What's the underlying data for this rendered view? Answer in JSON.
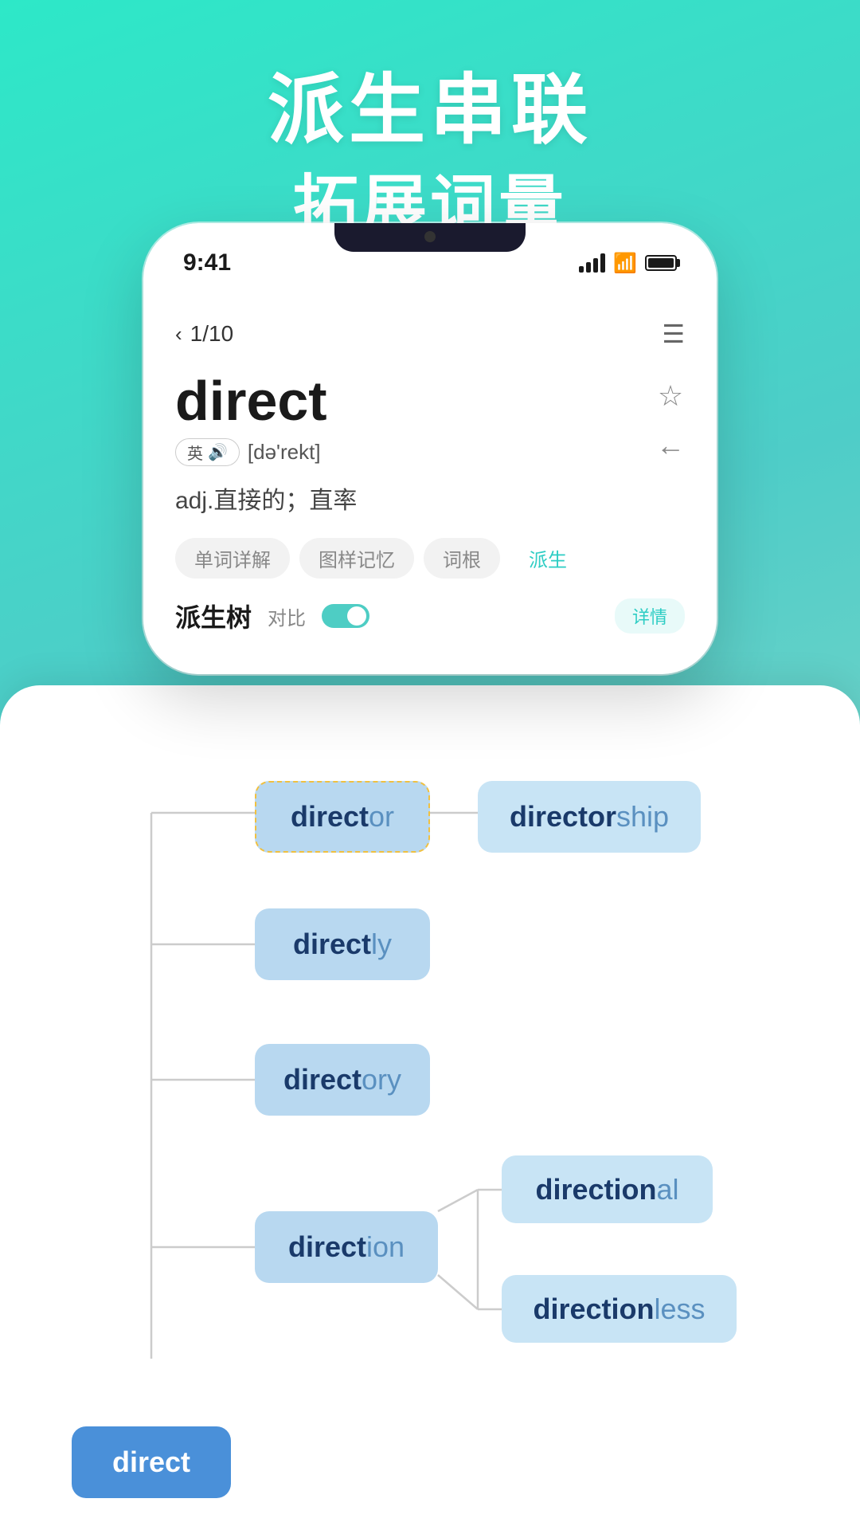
{
  "header": {
    "line1": "派生串联",
    "line2": "拓展词量"
  },
  "status": {
    "time": "9:41",
    "page": "1/10"
  },
  "word": {
    "title": "direct",
    "language": "英",
    "phonetic": "[də'rekt]",
    "definition": "adj.直接的；直率",
    "star_label": "★",
    "back_label": "←"
  },
  "tabs": [
    {
      "label": "单词详解",
      "active": false
    },
    {
      "label": "图样记忆",
      "active": false
    },
    {
      "label": "词根",
      "active": false
    },
    {
      "label": "派生",
      "active": true
    }
  ],
  "section": {
    "title": "派生树",
    "compare": "对比",
    "detail_btn": "详情"
  },
  "tree": {
    "root": "direct",
    "nodes": [
      {
        "id": "director",
        "bold": "direct",
        "light": "or",
        "has_dashed": true
      },
      {
        "id": "directorship",
        "bold": "director",
        "light": "ship"
      },
      {
        "id": "directly",
        "bold": "direct",
        "light": "ly"
      },
      {
        "id": "directory",
        "bold": "direct",
        "light": "ory"
      },
      {
        "id": "direction",
        "bold": "direct",
        "light": "ion"
      },
      {
        "id": "directional",
        "bold": "direction",
        "light": "al"
      },
      {
        "id": "directionless",
        "bold": "direction",
        "light": "less"
      }
    ]
  },
  "nav": {
    "chevron": "‹",
    "filter": "⊟"
  }
}
